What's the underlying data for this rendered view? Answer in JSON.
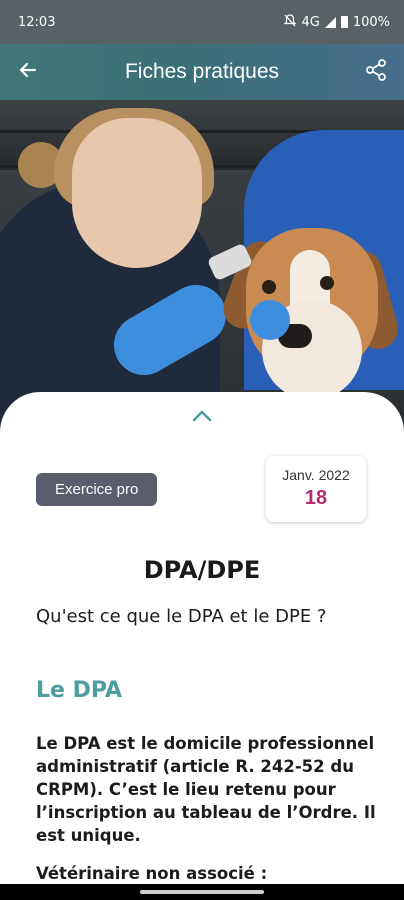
{
  "status_bar": {
    "time": "12:03",
    "network": "4G",
    "battery": "100%"
  },
  "app_bar": {
    "title": "Fiches pratiques"
  },
  "card": {
    "category": "Exercice pro",
    "date_month": "Janv. 2022",
    "date_day": "18"
  },
  "article": {
    "title": "DPA/DPE",
    "subtitle": "Qu'est ce que le DPA et le DPE ?",
    "section_heading": "Le DPA",
    "paragraph": "Le DPA est le domicile professionnel administratif (article R. 242-52 du CRPM). C’est le lieu retenu pour l’inscription au tableau de l’Ordre. Il est unique.",
    "subheading": "Vétérinaire non associé :"
  },
  "colors": {
    "app_bar_start": "#40777a",
    "section_heading": "#4d9ca0",
    "date_day": "#b12b74",
    "category_badge": "#5b5d6c"
  },
  "icons": {
    "back": "arrow-back-icon",
    "share": "share-icon",
    "collapse": "chevron-up-icon",
    "mute": "notifications-off-icon",
    "signal": "signal-icon",
    "battery": "battery-icon"
  }
}
